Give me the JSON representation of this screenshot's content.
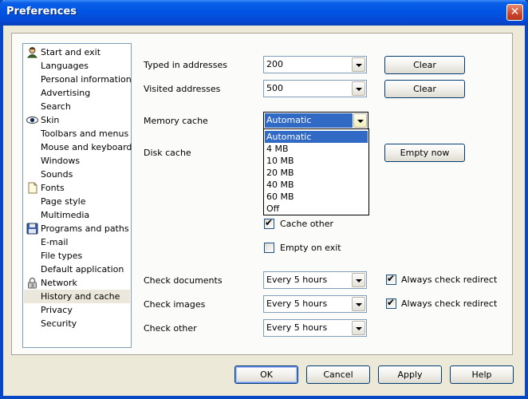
{
  "window": {
    "title": "Preferences",
    "close_glyph": "✕"
  },
  "categories": [
    {
      "label": "Start and exit",
      "icon": "person-icon"
    },
    {
      "label": "Languages",
      "icon": ""
    },
    {
      "label": "Personal information",
      "icon": ""
    },
    {
      "label": "Advertising",
      "icon": ""
    },
    {
      "label": "Search",
      "icon": ""
    },
    {
      "label": "Skin",
      "icon": "eye-icon"
    },
    {
      "label": "Toolbars and menus",
      "icon": ""
    },
    {
      "label": "Mouse and keyboard",
      "icon": ""
    },
    {
      "label": "Windows",
      "icon": ""
    },
    {
      "label": "Sounds",
      "icon": ""
    },
    {
      "label": "Fonts",
      "icon": "page-icon"
    },
    {
      "label": "Page style",
      "icon": ""
    },
    {
      "label": "Multimedia",
      "icon": ""
    },
    {
      "label": "Programs and paths",
      "icon": "disk-icon"
    },
    {
      "label": "E-mail",
      "icon": ""
    },
    {
      "label": "File types",
      "icon": ""
    },
    {
      "label": "Default application",
      "icon": ""
    },
    {
      "label": "Network",
      "icon": "lock-icon"
    },
    {
      "label": "History and cache",
      "icon": "",
      "selected": true
    },
    {
      "label": "Privacy",
      "icon": ""
    },
    {
      "label": "Security",
      "icon": ""
    }
  ],
  "settings": {
    "typed": {
      "label": "Typed in addresses",
      "value": "200",
      "button": "Clear"
    },
    "visited": {
      "label": "Visited addresses",
      "value": "500",
      "button": "Clear"
    },
    "memory": {
      "label": "Memory cache",
      "value": "Automatic",
      "options": [
        "Automatic",
        "4 MB",
        "10 MB",
        "20 MB",
        "40 MB",
        "60 MB",
        "Off"
      ],
      "highlighted_index": 0
    },
    "disk": {
      "label": "Disk cache",
      "button": "Empty now"
    },
    "cache_other": {
      "label": "Cache other",
      "checked": true
    },
    "empty_on_exit": {
      "label": "Empty on exit",
      "checked": false
    },
    "check_documents": {
      "label": "Check documents",
      "value": "Every 5 hours",
      "redirect_label": "Always check redirect",
      "redirect_checked": true
    },
    "check_images": {
      "label": "Check images",
      "value": "Every 5 hours",
      "redirect_label": "Always check redirect",
      "redirect_checked": true
    },
    "check_other": {
      "label": "Check other",
      "value": "Every 5 hours"
    }
  },
  "footer": {
    "ok": "OK",
    "cancel": "Cancel",
    "apply": "Apply",
    "help": "Help"
  },
  "colors": {
    "title_bar": "#0054e3",
    "selection": "#316ac5",
    "dialog_bg": "#ece9d8",
    "close_button": "#c9442a"
  }
}
